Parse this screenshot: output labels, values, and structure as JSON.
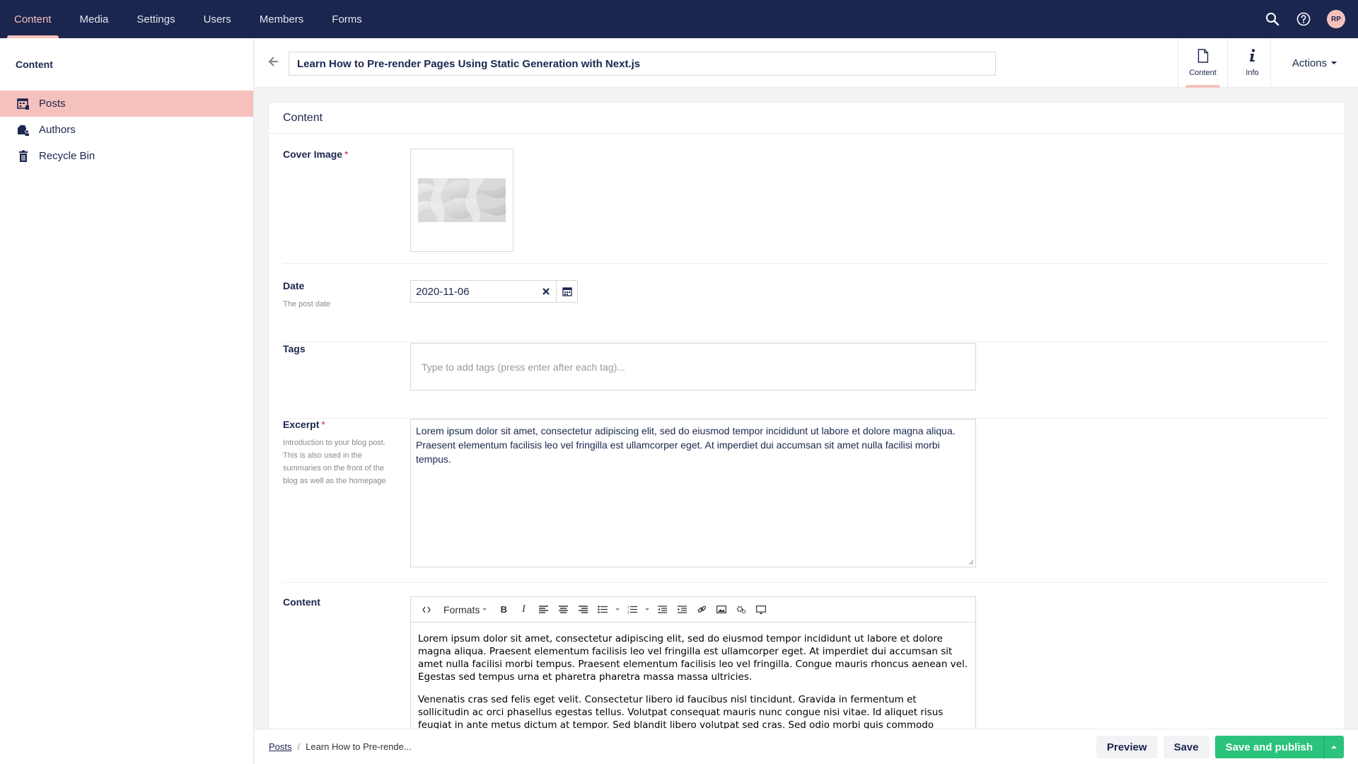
{
  "topnav": {
    "sections": [
      "Content",
      "Media",
      "Settings",
      "Users",
      "Members",
      "Forms"
    ],
    "active": "Content",
    "user_initials": "RP"
  },
  "sidebar": {
    "heading": "Content",
    "items": [
      {
        "label": "Posts",
        "icon": "posts-icon",
        "active": true
      },
      {
        "label": "Authors",
        "icon": "authors-icon",
        "active": false
      },
      {
        "label": "Recycle Bin",
        "icon": "trash-icon",
        "active": false
      }
    ]
  },
  "editor": {
    "title": "Learn How to Pre-render Pages Using Static Generation with Next.js",
    "apps": [
      {
        "label": "Content",
        "icon": "document-icon",
        "active": true
      },
      {
        "label": "Info",
        "icon": "info-icon",
        "active": false
      }
    ],
    "actions_label": "Actions"
  },
  "panel": {
    "title": "Content",
    "cover_image": {
      "label": "Cover Image",
      "required": "*"
    },
    "date": {
      "label": "Date",
      "description": "The post date",
      "value": "2020-11-06"
    },
    "tags": {
      "label": "Tags",
      "placeholder": "Type to add tags (press enter after each tag)..."
    },
    "excerpt": {
      "label": "Excerpt",
      "required": "*",
      "description": "Introduction to your blog post. This is also used in the summaries on the front of the blog as well as the homepage",
      "value": "Lorem ipsum dolor sit amet, consectetur adipiscing elit, sed do eiusmod tempor incididunt ut labore et dolore magna aliqua. Praesent elementum facilisis leo vel fringilla est ullamcorper eget. At imperdiet dui accumsan sit amet nulla facilisi morbi tempus."
    },
    "content": {
      "label": "Content",
      "formats_label": "Formats",
      "paragraphs": [
        "Lorem ipsum dolor sit amet, consectetur adipiscing elit, sed do eiusmod tempor incididunt ut labore et dolore magna aliqua. Praesent elementum facilisis leo vel fringilla est ullamcorper eget. At imperdiet dui accumsan sit amet nulla facilisi morbi tempus. Praesent elementum facilisis leo vel fringilla. Congue mauris rhoncus aenean vel. Egestas sed tempus urna et pharetra pharetra massa massa ultricies.",
        "Venenatis cras sed felis eget velit. Consectetur libero id faucibus nisl tincidunt. Gravida in fermentum et sollicitudin ac orci phasellus egestas tellus. Volutpat consequat mauris nunc congue nisi vitae. Id aliquet risus feugiat in ante metus dictum at tempor. Sed blandit libero volutpat sed cras. Sed odio morbi quis commodo"
      ]
    }
  },
  "footer": {
    "breadcrumb_root": "Posts",
    "breadcrumb_separator": "/",
    "breadcrumb_current": "Learn How to Pre-rende...",
    "preview_label": "Preview",
    "save_label": "Save",
    "publish_label": "Save and publish"
  },
  "colors": {
    "header_bg": "#1b264f",
    "accent_pink": "#f5c1bc",
    "publish_green": "#2bc37c",
    "required_red": "#d42054"
  }
}
